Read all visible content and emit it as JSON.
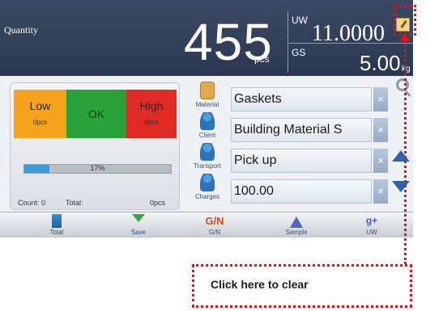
{
  "header": {
    "quantity_label": "Quantity",
    "quantity_value": "455",
    "quantity_unit": "pcs",
    "uw_label": "UW",
    "uw_value": "11.0000",
    "gs_label": "GS",
    "gs_value": "5.00",
    "gs_unit": "kg"
  },
  "status": {
    "low": {
      "label": "Low",
      "count": "0pcs"
    },
    "ok": {
      "label": "OK"
    },
    "high": {
      "label": "High",
      "count": "0pcs"
    },
    "progress_text": "17%",
    "progress_fraction": 0.17,
    "count_label": "Count: 0",
    "total_label": "Total:",
    "total_value": "0pcs"
  },
  "fields": [
    {
      "caption": "Material",
      "value": "Gaskets",
      "icon": "box-icon"
    },
    {
      "caption": "Client",
      "value": "Building Material S",
      "icon": "person-icon"
    },
    {
      "caption": "Transport",
      "value": "Pick up",
      "icon": "person-icon"
    },
    {
      "caption": "Charges",
      "value": "100.00",
      "icon": "person-icon"
    }
  ],
  "clear_glyph": "×",
  "toolbar": {
    "total": "Total",
    "save": "Save",
    "gn_icon": "G/N",
    "gn": "G/N",
    "sample": "Sample",
    "uw_icon": "g+",
    "uw": "UW"
  },
  "annotation": {
    "text": "Click here to clear",
    "color": "#e0141a"
  },
  "colors": {
    "header_bg": "#2f3c55",
    "low": "#f5a31c",
    "ok": "#28a33a",
    "high": "#e02a26",
    "progress": "#3b9ad8"
  }
}
